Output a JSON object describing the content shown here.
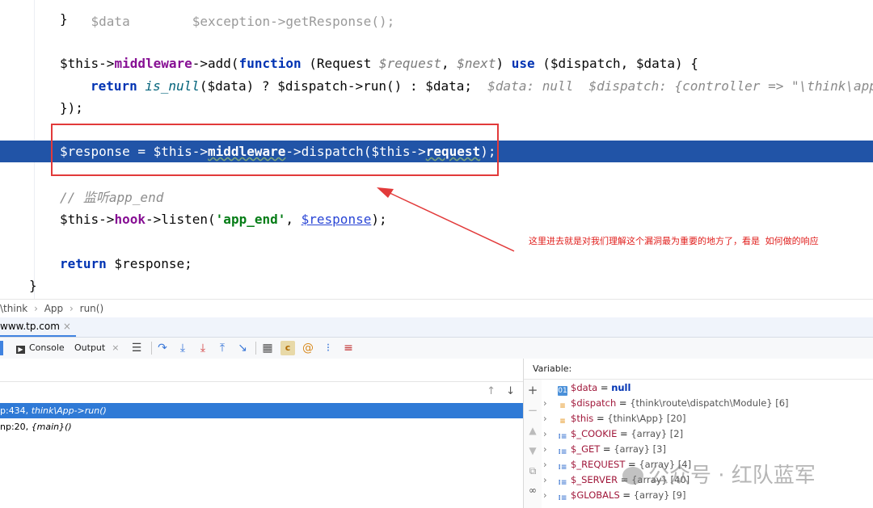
{
  "code": {
    "line0": "$data        $exception->getResponse();",
    "line1_brace": "}",
    "mw_this": "$this->",
    "mw_field": "middleware",
    "mw_arrow": "->add(",
    "mw_fn": "function",
    "mw_params_1": " (Request ",
    "mw_param_req": "$request",
    "mw_comma": ", ",
    "mw_param_next": "$next",
    "mw_close": ") ",
    "mw_use": "use",
    "mw_use_args": " ($dispatch, $data) {",
    "ret_kw": "return",
    "ret_call": " is_null",
    "ret_rest": "($data) ? $dispatch->run() : $data;",
    "ret_hint": "  $data: null  $dispatch: {controller => \"\\think\\app\"",
    "close_mw": "});",
    "resp_prefix": "$response = $this->",
    "resp_field": "middleware",
    "resp_mid": "->dispatch($this->",
    "resp_req": "request",
    "resp_end": ");",
    "comment": "// 监听app_end",
    "hook_this": "$this->",
    "hook_field": "hook",
    "hook_call": "->listen(",
    "hook_str": "'app_end'",
    "hook_comma": ", ",
    "hook_var": "$response",
    "hook_end": ");",
    "return_kw": "return",
    "return_rest": " $response;",
    "final_brace": "}"
  },
  "annotation": "这里进去就是对我们理解这个漏洞最为重要的地方了，看是 如何做的响应",
  "breadcrumb": [
    "\\think",
    "App",
    "run()"
  ],
  "breadcrumb_sep": "›",
  "debug_tab": {
    "label": "www.tp.com",
    "close": "×"
  },
  "toolbar": {
    "console": "Console",
    "output": "Output",
    "output_close": "×"
  },
  "frames": [
    {
      "prefix": "p:434, ",
      "method": "think\\App->run()"
    },
    {
      "prefix": "np:20, ",
      "method": "{main}()"
    }
  ],
  "variables_title": "Variable:",
  "variables": [
    {
      "icon": "01",
      "name": "$data",
      "eq": " = ",
      "value": "null",
      "expand": ""
    },
    {
      "icon": "obj",
      "name": "$dispatch",
      "eq": " = ",
      "value": "{think\\route\\dispatch\\Module} [6]",
      "expand": "›"
    },
    {
      "icon": "obj",
      "name": "$this",
      "eq": " = ",
      "value": "{think\\App} [20]",
      "expand": "›"
    },
    {
      "icon": "arr",
      "name": "$_COOKIE",
      "eq": " = ",
      "value": "{array} [2]",
      "expand": "›"
    },
    {
      "icon": "arr",
      "name": "$_GET",
      "eq": " = ",
      "value": "{array} [3]",
      "expand": "›"
    },
    {
      "icon": "arr",
      "name": "$_REQUEST",
      "eq": " = ",
      "value": "{array} [4]",
      "expand": "›"
    },
    {
      "icon": "arr",
      "name": "$_SERVER",
      "eq": " = ",
      "value": "{array} [40]",
      "expand": "›"
    },
    {
      "icon": "arr",
      "name": "$GLOBALS",
      "eq": " = ",
      "value": "{array} [9]",
      "expand": "›"
    }
  ],
  "watermark": "公众号 · 红队蓝军"
}
